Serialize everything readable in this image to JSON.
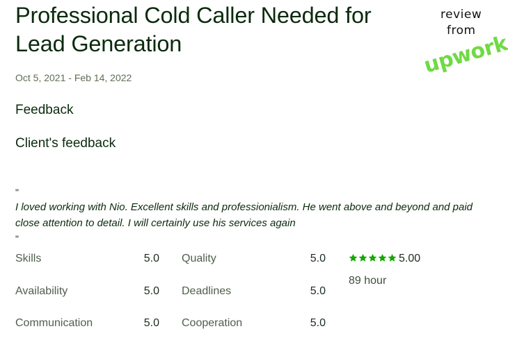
{
  "job": {
    "title_line1": "Professional Cold Caller Needed for",
    "title_line2": "Lead Generation",
    "dates": "Oct 5, 2021 - Feb 14, 2022"
  },
  "feedback": {
    "heading": "Feedback",
    "client_heading": "Client's feedback",
    "open_quote": "\"",
    "close_quote": "\"",
    "comment": "I loved working with Nio. Excellent skills and professionialism. He went above and beyond and paid close attention to detail. I will certainly use his services again"
  },
  "ratings": {
    "skills": {
      "label": "Skills",
      "value": "5.0"
    },
    "quality": {
      "label": "Quality",
      "value": "5.0"
    },
    "availability": {
      "label": "Availability",
      "value": "5.0"
    },
    "deadlines": {
      "label": "Deadlines",
      "value": "5.0"
    },
    "communication": {
      "label": "Communication",
      "value": "5.0"
    },
    "cooperation": {
      "label": "Cooperation",
      "value": "5.0"
    }
  },
  "overall": {
    "score": "5.00",
    "stars": 5,
    "hours": "89 hour"
  },
  "badge": {
    "line1": "review",
    "line2": "from",
    "logo_text": "upwork",
    "logo_color": "#6fda44"
  },
  "colors": {
    "star": "#14a800",
    "title": "#0b2a0d",
    "muted": "#5e6d55"
  }
}
